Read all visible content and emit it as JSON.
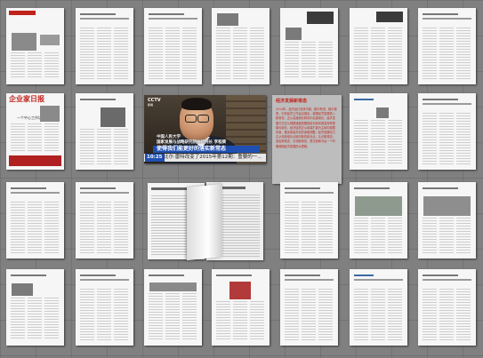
{
  "board": {
    "accent": "#c0231b",
    "background": "#808080"
  },
  "thumbs": {
    "r2c1": {
      "title": "企业家日报",
      "subtitle": "一个中心工作坊"
    }
  },
  "video": {
    "channel": "CCTV",
    "channel_sub": "新闻",
    "name_line1": "中国人民大学",
    "name_line2": "国家发展与战略研究院执行院长 李稻葵",
    "caption": "使得我们能更好的落实新常态",
    "time": "10:25",
    "ticker": "比尔·雷特改变了2015年第12期：重要的一..."
  },
  "card": {
    "title": "经济发展新常态",
    "body": "2014年，经济运行总体平稳，稳中有进，稳中提质。中央经济工作会议指出，我国经济发展进入新常态，正从高速增长转向中高速增长，经济发展方式正从规模速度型粗放增长转向质量效率型集约增长，经济结构正从增量扩能为主转向调整存量、做优增量并存的深度调整，经济发展动力正从传统增长点转向新的增长点。认识新常态，适应新常态，引领新常态，是当前和今后一个时期我国经济发展的大逻辑。"
  }
}
